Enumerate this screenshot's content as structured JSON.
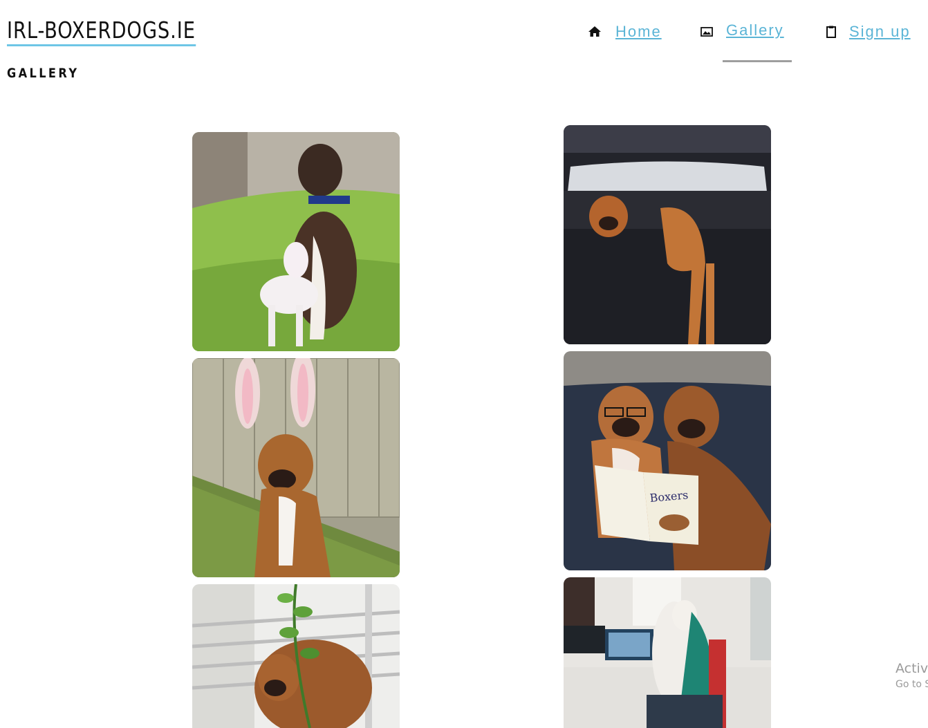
{
  "site": {
    "brand": "IRL-BOXERDOGS.IE",
    "page_title": "GALLERY"
  },
  "nav": {
    "items": [
      {
        "label": "Home",
        "icon": "home-icon"
      },
      {
        "label": "Gallery",
        "icon": "image-icon",
        "active": true
      },
      {
        "label": "Sign up",
        "icon": "clipboard-icon"
      }
    ],
    "link_color": "#5ab4d6",
    "active_bar_color": "#9e9e9e"
  },
  "gallery": {
    "photos": [
      {
        "subject": "boxer-with-goat"
      },
      {
        "subject": "boxer-in-car-boot"
      },
      {
        "subject": "boxer-with-bunny-ears"
      },
      {
        "subject": "boxers-reading-book",
        "caption": "Boxers"
      },
      {
        "subject": "boxer-by-plant"
      },
      {
        "subject": "boxer-at-office-desk"
      }
    ]
  },
  "watermark": {
    "line1": "Activa",
    "line2": "Go to S"
  }
}
